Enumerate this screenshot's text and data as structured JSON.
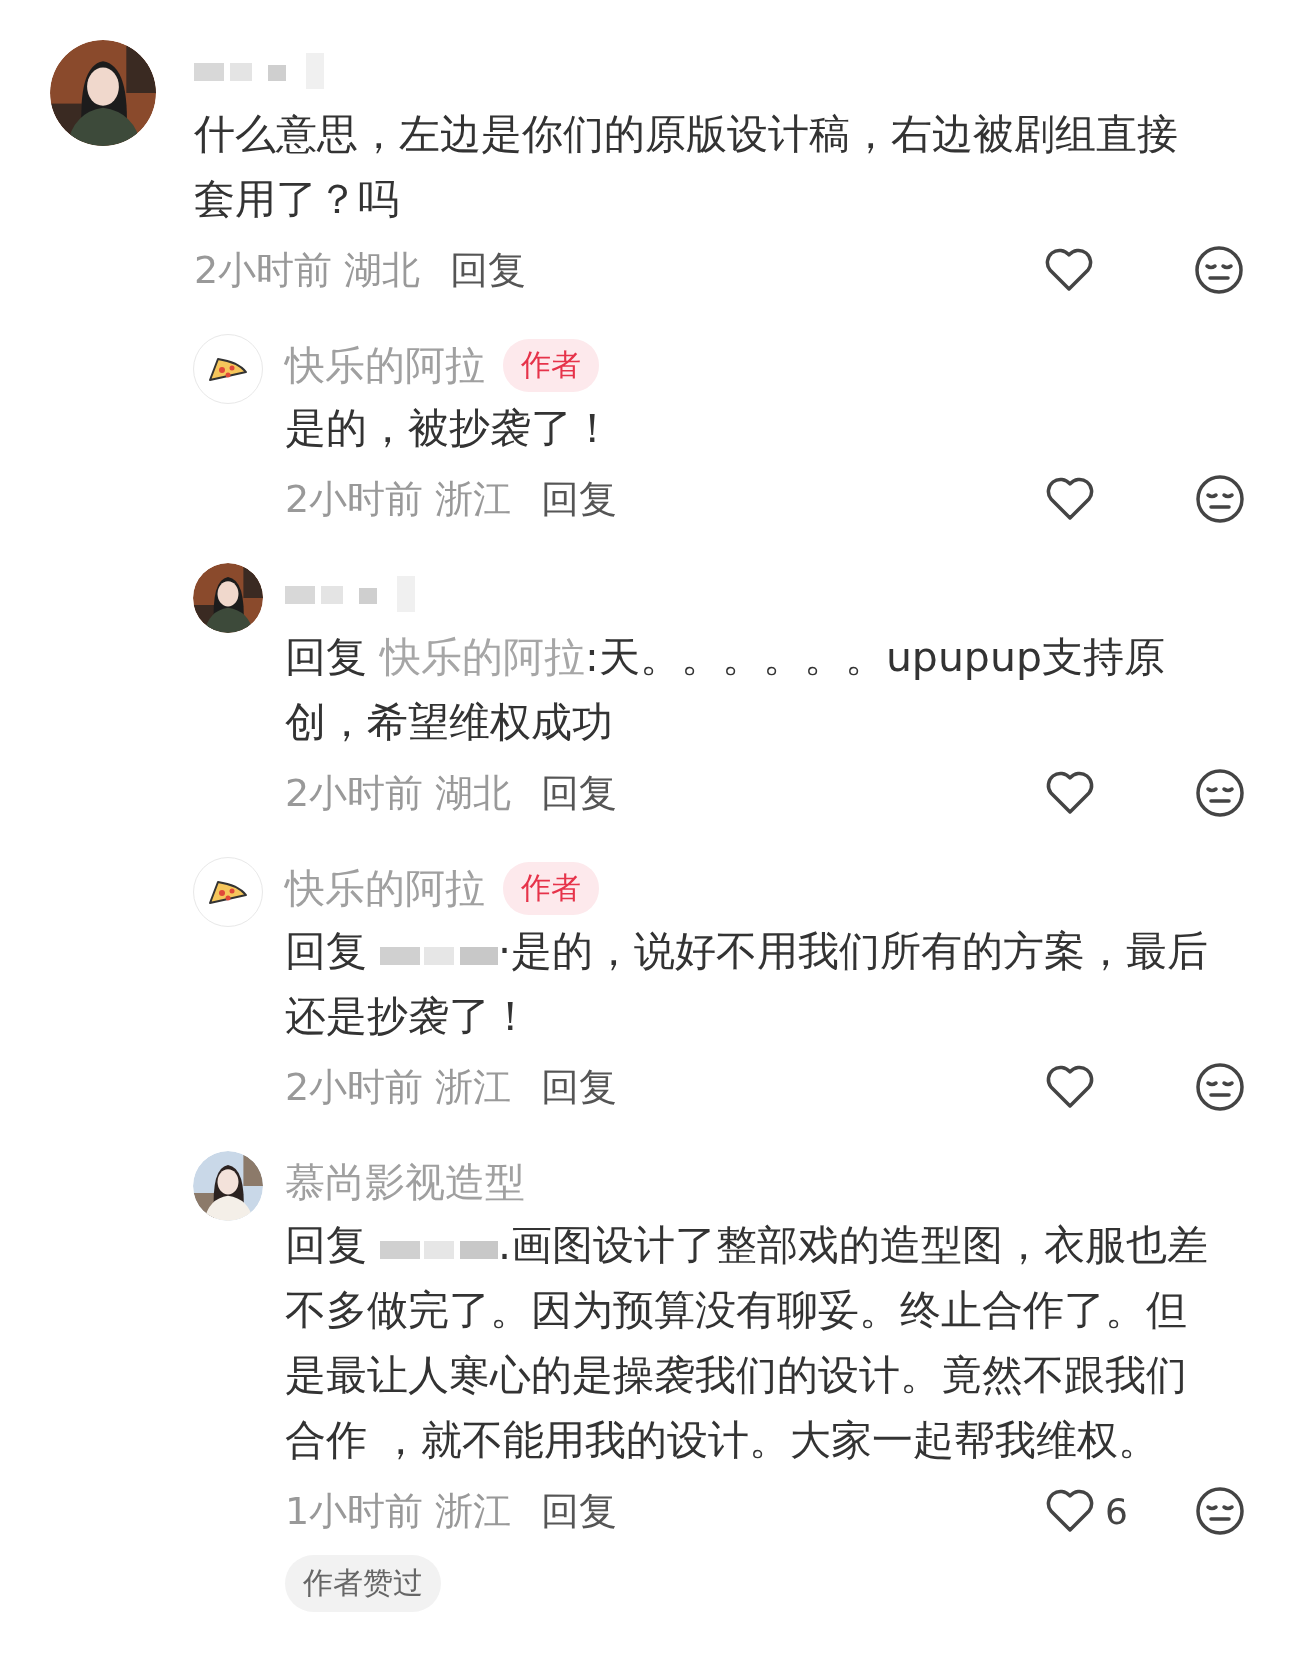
{
  "comments": [
    {
      "kind": "comment",
      "name_blurred": true,
      "text": "什么意思，左边是你们的原版设计稿，右边被剧组直接套用了？吗",
      "time": "2小时前",
      "region": "湖北",
      "reply_label": "回复"
    },
    {
      "kind": "reply",
      "avatar": {
        "kind": "pizza"
      },
      "name": "快乐的阿拉",
      "author": "作者",
      "text": "是的，被抄袭了！",
      "time": "2小时前",
      "region": "浙江",
      "reply_label": "回复"
    },
    {
      "kind": "reply",
      "name_blurred": true,
      "reply_to": {
        "prefix": "回复",
        "name": "快乐的阿拉",
        "sep": ":"
      },
      "text": "天。。。。。。upupup支持原创，希望维权成功",
      "time": "2小时前",
      "region": "湖北",
      "reply_label": "回复"
    },
    {
      "kind": "reply",
      "avatar": {
        "kind": "pizza"
      },
      "name": "快乐的阿拉",
      "author": "作者",
      "reply_to": {
        "prefix": "回复",
        "name_blurred": true,
        "sep": "·"
      },
      "text": "是的，说好不用我们所有的方案，最后还是抄袭了！",
      "time": "2小时前",
      "region": "浙江",
      "reply_label": "回复"
    },
    {
      "kind": "reply",
      "name": "慕尚影视造型",
      "reply_to": {
        "prefix": "回复",
        "name_blurred": true,
        "sep": "."
      },
      "text": "画图设计了整部戏的造型图，衣服也差不多做完了。因为预算没有聊妥。终止合作了。但是最让人寒心的是操袭我们的设计。竟然不跟我们合作 ，就不能用我的设计。大家一起帮我维权。",
      "time": "1小时前",
      "region": "浙江",
      "reply_label": "回复",
      "likes": "6",
      "badge": "作者赞过"
    }
  ]
}
